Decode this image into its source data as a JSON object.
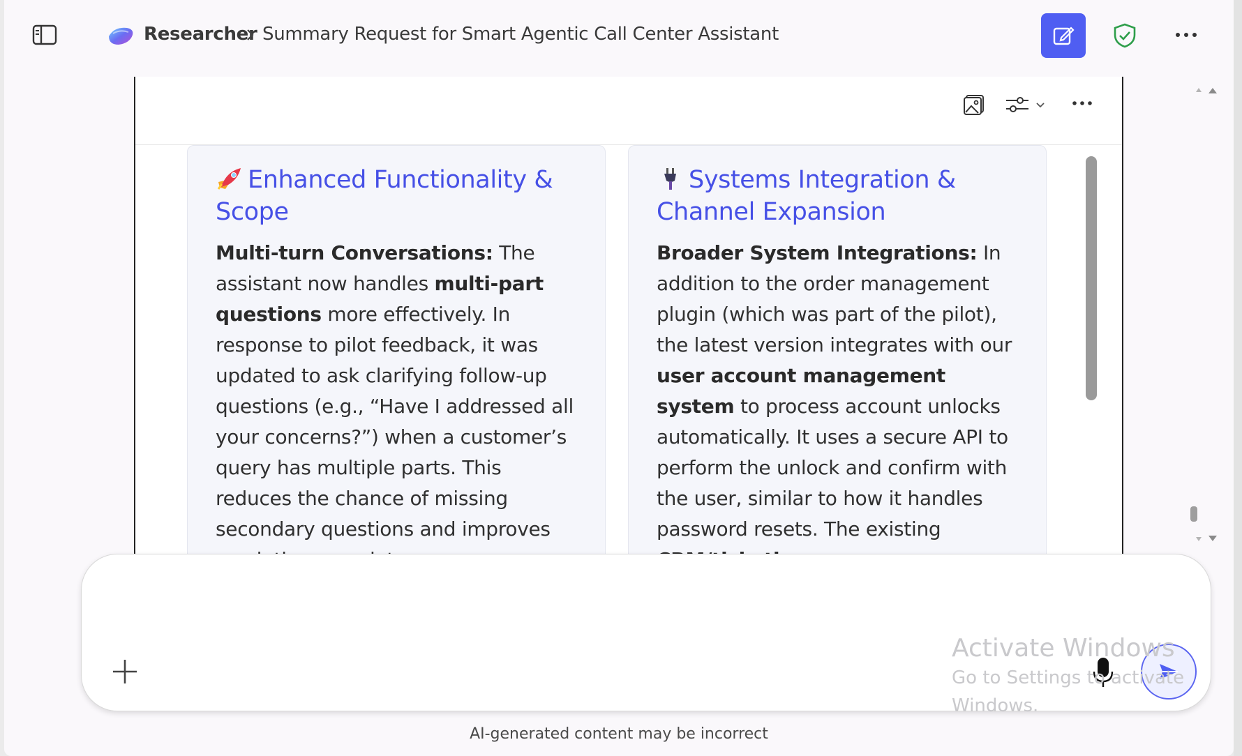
{
  "header": {
    "agent_name": "Researcher",
    "page_title": "Summary Request for Smart Agentic Call Center Assistant"
  },
  "cards": [
    {
      "icon": "rocket-emoji",
      "title": "Enhanced Functionality & Scope",
      "body_parts": [
        {
          "t": "Multi-turn Conversations:",
          "b": true
        },
        {
          "t": " The assistant now handles ",
          "b": false
        },
        {
          "t": "multi-part questions",
          "b": true
        },
        {
          "t": " more effectively. In response to pilot feedback, it was updated to ask clarifying follow-up questions (e.g., “Have I addressed all your concerns?”) when a customer’s query has multiple parts. This reduces the chance of missing secondary questions and improves resolution completeness.",
          "b": false
        }
      ]
    },
    {
      "icon": "plug-emoji",
      "title": "Systems Integration & Channel Expansion",
      "body_parts": [
        {
          "t": "Broader System Integrations:",
          "b": true
        },
        {
          "t": " In addition to the order management plugin (which was part of the pilot), the latest version integrates with our ",
          "b": false
        },
        {
          "t": "user account management system",
          "b": true
        },
        {
          "t": " to process account unlocks automatically. It uses a secure API to perform the unlock and confirm with the user, similar to how it handles password resets. The existing ",
          "b": false
        },
        {
          "t": "CRM/ticketing",
          "b": true
        }
      ]
    }
  ],
  "composer": {
    "placeholder": ""
  },
  "watermark": {
    "line1": "Activate Windows",
    "line2": "Go to Settings to activate Windows."
  },
  "footer": {
    "disclaimer": "AI-generated content may be incorrect"
  },
  "colors": {
    "accent": "#4f5ef2",
    "heading": "#4650e6",
    "shield": "#2e9e4a"
  }
}
